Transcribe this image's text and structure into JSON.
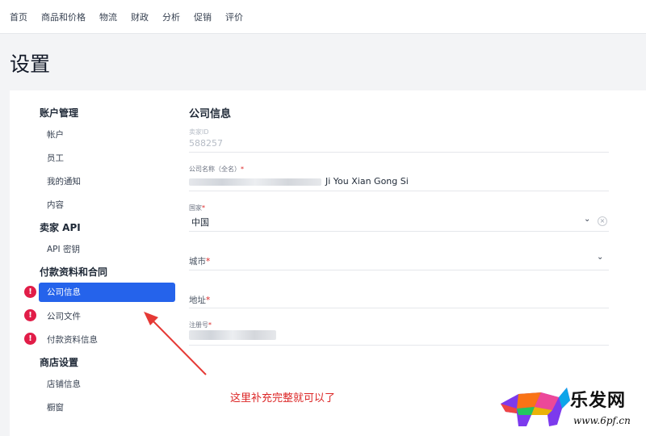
{
  "nav": {
    "items": [
      "首页",
      "商品和价格",
      "物流",
      "财政",
      "分析",
      "促销",
      "评价"
    ]
  },
  "page": {
    "title": "设置"
  },
  "sidebar": {
    "sections": [
      {
        "title": "账户管理",
        "items": [
          "帐户",
          "员工",
          "我的通知",
          "内容"
        ]
      },
      {
        "title": "卖家 API",
        "items": [
          "API 密钥"
        ]
      },
      {
        "title": "付款资料和合同",
        "items": [
          "公司信息",
          "公司文件",
          "付款资料信息"
        ]
      },
      {
        "title": "商店设置",
        "items": [
          "店铺信息",
          "橱窗"
        ]
      }
    ]
  },
  "form": {
    "title": "公司信息",
    "seller_id": {
      "label": "卖家ID",
      "value": "588257"
    },
    "company_name": {
      "label": "公司名称（全名）",
      "required": "*",
      "value": "Ji You Xian Gong Si"
    },
    "country": {
      "label": "国家",
      "required": "*",
      "value": "中国"
    },
    "city": {
      "label": "城市",
      "required": "*"
    },
    "address": {
      "label": "地址",
      "required": "*"
    },
    "reg_no": {
      "label": "注册号",
      "required": "*"
    }
  },
  "annotation": {
    "text": "这里补充完整就可以了"
  },
  "watermark": {
    "brand": "乐发网",
    "url": "www.6pf.cn"
  },
  "colors": {
    "accent": "#2563eb",
    "alert": "#e11d48",
    "annotation": "#dc2626"
  },
  "icons": [
    "chevron-down-icon",
    "clear-icon",
    "alert-icon",
    "arrow-annotation"
  ]
}
